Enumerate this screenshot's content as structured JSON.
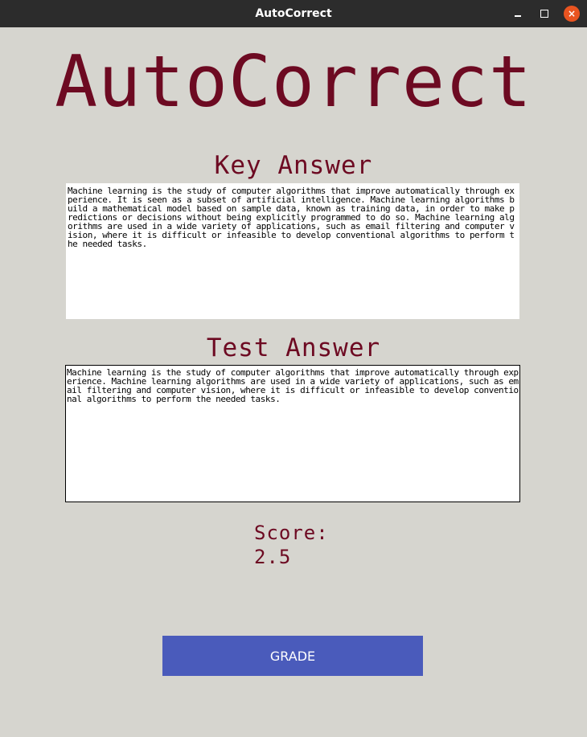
{
  "window": {
    "title": "AutoCorrect",
    "controls": {
      "minimize_icon": "minimize-icon",
      "maximize_icon": "maximize-icon",
      "close_icon": "close-icon",
      "close_glyph": "×"
    }
  },
  "app": {
    "title": "AutoCorrect"
  },
  "key_answer": {
    "label": "Key Answer",
    "text": "Machine learning is the study of computer algorithms that improve automatically through experience. It is seen as a subset of artificial intelligence. Machine learning algorithms build a mathematical model based on sample data, known as training data, in order to make predictions or decisions without being explicitly programmed to do so. Machine learning algorithms are used in a wide variety of applications, such as email filtering and computer vision, where it is difficult or infeasible to develop conventional algorithms to perform the needed tasks."
  },
  "test_answer": {
    "label": "Test Answer",
    "text": "Machine learning is the study of computer algorithms that improve automatically through experience. Machine learning algorithms are used in a wide variety of applications, such as email filtering and computer vision, where it is difficult or infeasible to develop conventional algorithms to perform the needed tasks."
  },
  "score": {
    "label": "Score:",
    "value": "2.5"
  },
  "grade_button": {
    "label": "GRADE"
  },
  "colors": {
    "background": "#d6d5cf",
    "accent": "#6d0a22",
    "button": "#4a5bbb",
    "titlebar": "#2c2c2c",
    "close": "#e95420"
  }
}
